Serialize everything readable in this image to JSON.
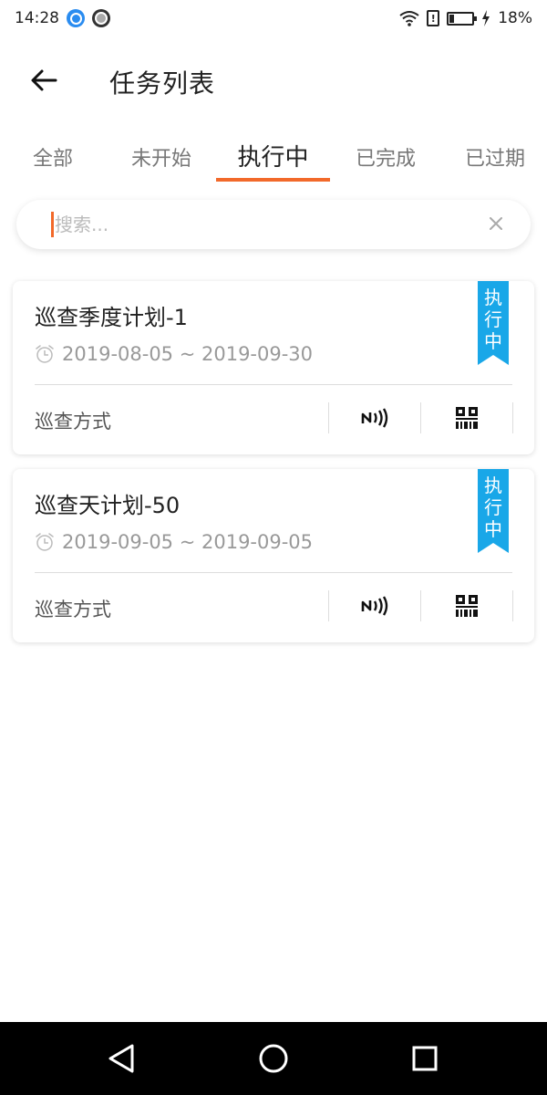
{
  "status_bar": {
    "time": "14:28",
    "battery": "18%",
    "icons": [
      "app-notification-icon",
      "record-icon",
      "wifi-icon",
      "alert-icon",
      "battery-icon",
      "charging-icon"
    ]
  },
  "header": {
    "title": "任务列表",
    "back_icon": "arrow-left-icon"
  },
  "tabs": [
    {
      "label": "全部",
      "active": false
    },
    {
      "label": "未开始",
      "active": false
    },
    {
      "label": "执行中",
      "active": true
    },
    {
      "label": "已完成",
      "active": false
    },
    {
      "label": "已过期",
      "active": false
    }
  ],
  "search": {
    "placeholder": "搜索...",
    "value": "",
    "clear_icon": "close-icon"
  },
  "tasks": [
    {
      "title": "巡查季度计划-1",
      "date_range": "2019-08-05 ~ 2019-09-30",
      "status_ribbon": [
        "执",
        "行",
        "中"
      ],
      "method_label": "巡查方式",
      "methods": [
        "nfc-icon",
        "qr-code-icon"
      ]
    },
    {
      "title": "巡查天计划-50",
      "date_range": "2019-09-05 ~ 2019-09-05",
      "status_ribbon": [
        "执",
        "行",
        "中"
      ],
      "method_label": "巡查方式",
      "methods": [
        "nfc-icon",
        "qr-code-icon"
      ]
    }
  ],
  "colors": {
    "accent": "#f2692a",
    "ribbon": "#19a7e8",
    "nav_bar": "#000000"
  },
  "nav_bar": {
    "icons": [
      "back-triangle-icon",
      "home-circle-icon",
      "recents-square-icon"
    ]
  }
}
